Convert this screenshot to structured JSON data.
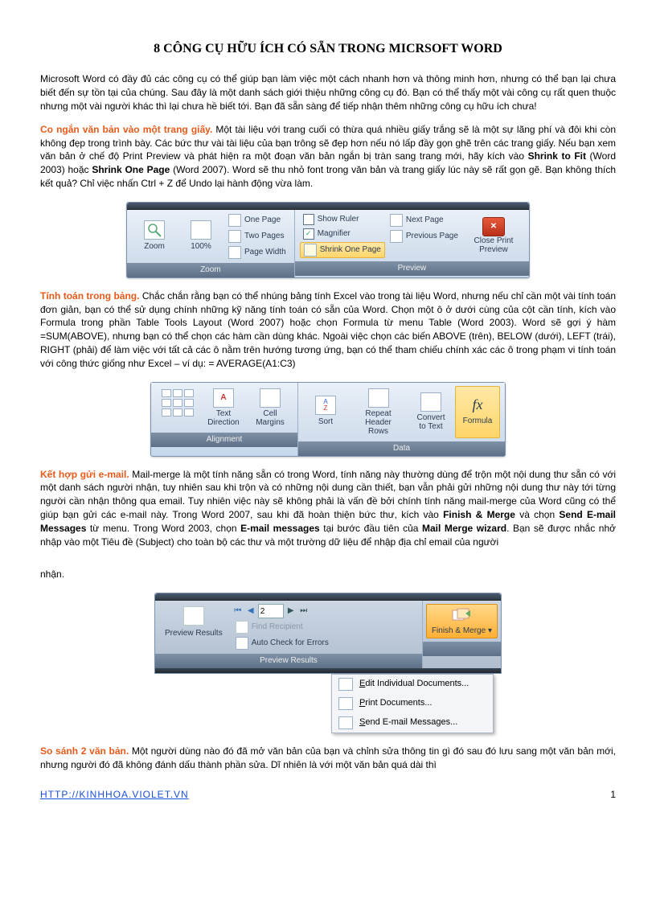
{
  "title_main": "8 CÔNG CỤ HỮU ÍCH CÓ SẴN TRONG MICRSOFT ",
  "title_word": "WORD",
  "intro": "Microsoft Word có đầy đủ các công cụ có thể giúp bạn làm việc một cách nhanh hơn và thông minh hơn, nhưng có thể bạn lại chưa biết đến sự tồn tại của chúng. Sau đây là một danh sách giới thiệu những công cụ đó. Bạn có thể thấy một vài công cụ rất quen thuộc nhưng một vài người khác thì lại chưa hề biết tới. Bạn đã sẵn sàng để tiếp nhận thêm những công cụ hữu ích chưa!",
  "s1": {
    "head": "Co ngắn văn bản vào một trang giấy.",
    "body_a": " Một tài liệu với trang cuối có thừa quá nhiều giấy trắng sẽ là một sự lãng phí và đôi khi còn không đẹp trong trình bày. Các bức thư vài tài liệu của bạn trông sẽ đẹp hơn nếu nó lấp đầy gọn ghẽ trên các trang giấy. Nếu bạn xem văn bản ở chế độ Print Preview và phát hiện ra một đoạn văn bản ngắn bị tràn sang trang mới, hãy kích vào ",
    "b1": "Shrink to Fit",
    "body_b": " (Word 2003) hoặc ",
    "b2": "Shrink One Page",
    "body_c": " (Word 2007). Word sẽ thu nhỏ font trong văn bản và trang giấy lúc này sẽ rất gọn gẽ. Bạn không thích kết quả? Chỉ việc nhấn Ctrl + Z để Undo lại hành động vừa làm."
  },
  "fig1": {
    "zoom": "Zoom",
    "hundred": "100%",
    "one_page": "One Page",
    "two_pages": "Two Pages",
    "page_width": "Page Width",
    "show_ruler": "Show Ruler",
    "magnifier": "Magnifier",
    "shrink": "Shrink One Page",
    "next_page": "Next Page",
    "prev_page": "Previous Page",
    "close": "Close Print Preview",
    "g_zoom": "Zoom",
    "g_preview": "Preview"
  },
  "s2": {
    "head": "Tính toán trong bảng.",
    "body": " Chắc chắn rằng bạn có thể nhúng bảng tính Excel vào trong tài liệu Word, nhưng nếu chỉ cần một vài tính toán đơn giản, bạn có thể sử dụng chính những kỹ năng tính toán có sẵn của Word. Chọn một ô ở dưới cùng của cột cần tính, kích vào Formula trong phần Table Tools Layout (Word 2007) hoặc chọn Formula từ menu Table (Word 2003). Word sẽ gợi ý hàm =SUM(ABOVE), nhưng bạn có thể chọn các hàm cần dùng khác. Ngoài việc chọn các biến ABOVE (trên), BELOW (dưới), LEFT (trái), RIGHT (phải) để làm việc với tất cả các ô nằm trên hướng tương ứng, bạn có thể tham chiếu chính xác các ô trong phạm vi tính toán với công thức giống như Excel – ví dụ: = AVERAGE(A1:C3)"
  },
  "fig2": {
    "text_dir": "Text Direction",
    "cell_marg": "Cell Margins",
    "sort": "Sort",
    "repeat": "Repeat Header Rows",
    "convert": "Convert to Text",
    "formula": "Formula",
    "g_align": "Alignment",
    "g_data": "Data",
    "az": "A",
    "za": "Z",
    "fx": "fx"
  },
  "s3": {
    "head": "Kết hợp gửi e-mail.",
    "body_a": " Mail-merge là một tính năng sẵn có trong Word, tính năng này thường dùng để trộn một nội dung thư sẵn có với một danh sách người nhận, tuy nhiên sau khi trộn và có những nội dung cần thiết, bạn vẫn phải gửi những nội dung thư này tới từng người cần nhận thông qua email. Tuy nhiên việc này sẽ không phải là vấn đề bởi chính tính năng mail-merge của Word cũng có thể giúp bạn gửi các e-mail này. Trong Word 2007, sau khi đã hoàn thiện bức thư, kích vào ",
    "b1": "Finish & Merge",
    "body_b": " và chọn ",
    "b2": "Send E-mail Messages",
    "body_c": " từ menu. Trong Word 2003, chọn ",
    "b3": "E-mail messages",
    "body_d": " tại bước đầu tiên của ",
    "b4": "Mail Merge wizard",
    "body_e": ". Bạn sẽ được nhắc nhở nhập vào một Tiêu đề (Subject) cho toàn bộ các thư và một trường dữ liệu để nhập địa chỉ email của người"
  },
  "s3_tail": "nhận.",
  "fig3": {
    "preview_results": "Preview Results",
    "page_val": "2",
    "find": "Find Recipient",
    "auto": "Auto Check for Errors",
    "finish": "Finish & Merge",
    "g_prev": "Preview Results",
    "m1": "Edit Individual Documents...",
    "m2": "Print Documents...",
    "m3": "Send E-mail Messages..."
  },
  "s4": {
    "head": "So sánh 2 văn bản.",
    "body": " Một người dùng nào đó đã mở văn bản của bạn và chỉnh sửa thông tin gì đó sau đó lưu sang một văn bản mới, nhưng người đó đã không đánh dấu thành phần sửa. Dĩ nhiên là với một văn bản quá dài thì"
  },
  "footer": {
    "url": "HTTP://KINHHOA.VIOLET.VN",
    "page": "1"
  }
}
